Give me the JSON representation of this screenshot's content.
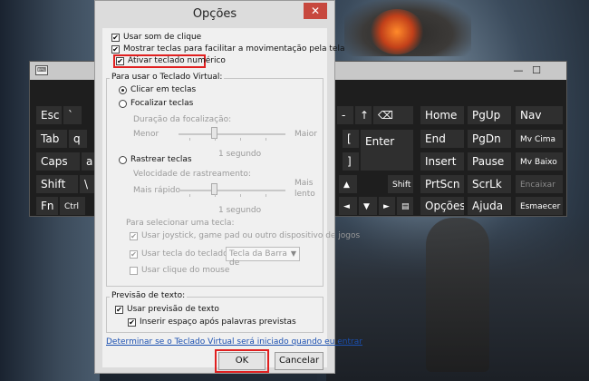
{
  "dialog": {
    "title": "Opções",
    "close_glyph": "✕",
    "options": {
      "click_sound": {
        "label": "Usar som de clique",
        "checked": true
      },
      "show_keys": {
        "label": "Mostrar teclas para facilitar a movimentação pela tela",
        "checked": true
      },
      "numeric_keypad": {
        "label": "Ativar teclado numérico",
        "checked": true
      }
    },
    "usage_group": {
      "label": "Para usar o Teclado Virtual:",
      "click_keys": {
        "label": "Clicar em teclas",
        "selected": true
      },
      "hover_keys": {
        "label": "Focalizar teclas",
        "selected": false
      },
      "hover_duration_label": "Duração da focalização:",
      "hover_min": "Menor",
      "hover_max": "Maior",
      "hover_value": "1 segundo",
      "scan_keys": {
        "label": "Rastrear teclas",
        "selected": false
      },
      "scan_speed_label": "Velocidade de rastreamento:",
      "scan_min": "Mais rápido",
      "scan_max_line1": "Mais",
      "scan_max_line2": "lento",
      "scan_value": "1 segundo",
      "select_key_label": "Para selecionar uma tecla:",
      "use_joystick": {
        "label": "Usar joystick, game pad ou outro dispositivo de jogos",
        "checked": true
      },
      "use_keyboard_key": {
        "label": "Usar tecla do teclado",
        "checked": true
      },
      "keyboard_key_select": "Tecla da Barra de",
      "use_mouse_click": {
        "label": "Usar clique do mouse",
        "checked": false
      }
    },
    "prediction_group": {
      "label": "Previsão de texto:",
      "use_prediction": {
        "label": "Usar previsão de texto",
        "checked": true
      },
      "insert_space": {
        "label": "Inserir espaço após palavras previstas",
        "checked": true
      }
    },
    "startup_link": "Determinar se o Teclado Virtual será iniciado quando eu entrar",
    "ok_label": "OK",
    "cancel_label": "Cancelar"
  },
  "osk": {
    "min_glyph": "—",
    "max_glyph": "☐",
    "app_icon_glyph": "⌨",
    "keys": {
      "esc": "Esc",
      "tab": "Tab",
      "caps": "Caps",
      "shift": "Shift",
      "fn": "Fn",
      "ctrl": "Ctrl",
      "q": "q",
      "a": "a",
      "backslash": "\\",
      "backtick": "`",
      "bracket_open": "[",
      "bracket_close": "]",
      "minus": "-",
      "equal": "=",
      "up_arrow": "↑",
      "backspace": "⌫",
      "enter": "Enter",
      "up": "▲",
      "shift_r": "Shift",
      "left": "◄",
      "down": "▼",
      "right": "►",
      "menu": "▤",
      "home": "Home",
      "pgup": "PgUp",
      "nav": "Nav",
      "end": "End",
      "pgdn": "PgDn",
      "mvcima": "Mv Cima",
      "insert": "Insert",
      "pause": "Pause",
      "mvbaixo": "Mv Baixo",
      "prtscn": "PrtScn",
      "scrlk": "ScrLk",
      "encaixar": "Encaixar",
      "opcoes": "Opções",
      "ajuda": "Ajuda",
      "esmaecer": "Esmaecer"
    }
  }
}
